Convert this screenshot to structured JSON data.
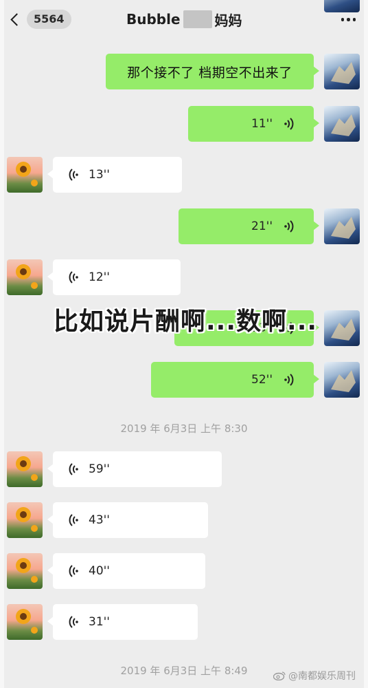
{
  "header": {
    "back_badge": "5564",
    "title_prefix": "Bubble",
    "title_suffix": "妈妈"
  },
  "messages": [
    {
      "side": "out",
      "type": "text",
      "text": "那个接不了 档期空不出来了"
    },
    {
      "side": "out",
      "type": "voice",
      "duration": "11''"
    },
    {
      "side": "in",
      "type": "voice",
      "duration": "13''"
    },
    {
      "side": "out",
      "type": "voice",
      "duration": "21''"
    },
    {
      "side": "in",
      "type": "voice",
      "duration": "12''"
    },
    {
      "side": "out",
      "type": "voice",
      "duration": "23''"
    },
    {
      "side": "out",
      "type": "voice",
      "duration": "52''"
    },
    {
      "side": "in",
      "type": "voice",
      "duration": "59''"
    },
    {
      "side": "in",
      "type": "voice",
      "duration": "43''"
    },
    {
      "side": "in",
      "type": "voice",
      "duration": "40''"
    },
    {
      "side": "in",
      "type": "voice",
      "duration": "31''"
    }
  ],
  "timestamps": [
    "2019 年 6月3日 上午 8:30",
    "2019 年 6月3日 上午 8:49"
  ],
  "overlay_caption": "比如说片酬啊...数啊...",
  "watermark": "@南都娱乐周刊",
  "colors": {
    "background": "#ededed",
    "outgoing_bubble": "#95ec69",
    "incoming_bubble": "#ffffff",
    "timestamp_text": "#a0a0a0"
  },
  "icons": [
    "back-chevron-icon",
    "more-icon",
    "voice-wave-icon",
    "weibo-icon"
  ]
}
